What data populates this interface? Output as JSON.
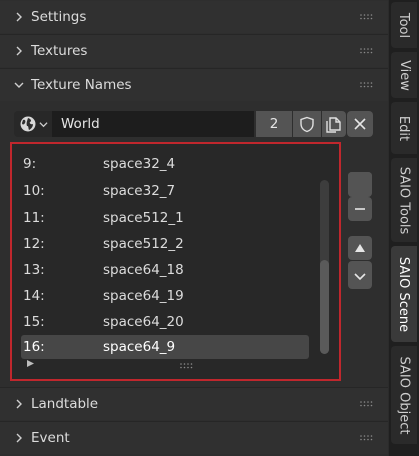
{
  "sections": {
    "settings": "Settings",
    "textures": "Textures",
    "texture_names": "Texture Names",
    "landtable": "Landtable",
    "event": "Event"
  },
  "texture_names": {
    "world_value": "World",
    "count": "2",
    "items": [
      {
        "index": "9:",
        "name": "space32_4"
      },
      {
        "index": "10:",
        "name": "space32_7"
      },
      {
        "index": "11:",
        "name": "space512_1"
      },
      {
        "index": "12:",
        "name": "space512_2"
      },
      {
        "index": "13:",
        "name": "space64_18"
      },
      {
        "index": "14:",
        "name": "space64_19"
      },
      {
        "index": "15:",
        "name": "space64_20"
      },
      {
        "index": "16:",
        "name": "space64_9"
      }
    ],
    "selected_index": 7
  },
  "tabs": [
    "Tool",
    "View",
    "Edit",
    "SAIO Tools",
    "SAIO Scene",
    "SAIO Object"
  ],
  "active_tab": "SAIO Scene",
  "colors": {
    "highlight_border": "#c0272d",
    "background": "#2e2e2e",
    "button": "#545454"
  }
}
